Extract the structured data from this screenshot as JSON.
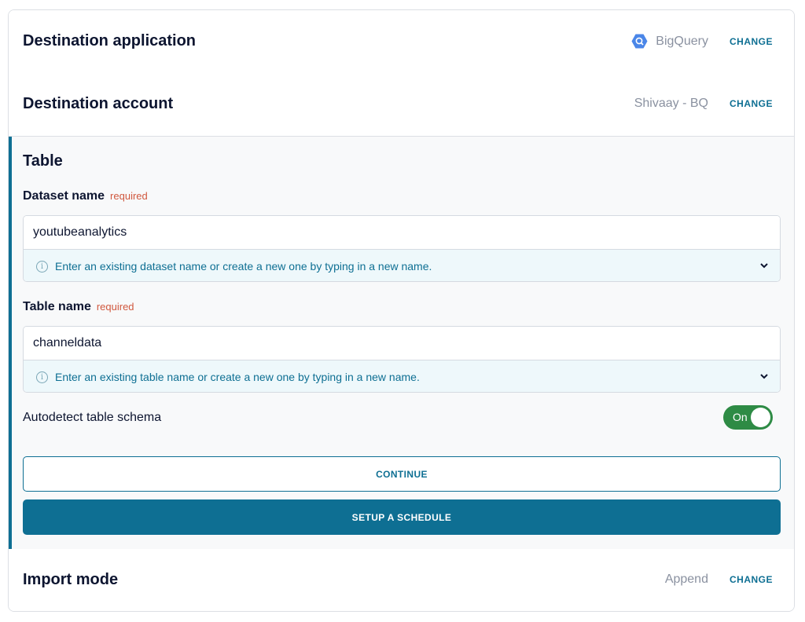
{
  "destination_application": {
    "title": "Destination application",
    "value": "BigQuery",
    "value_icon": "bigquery-icon",
    "change_label": "CHANGE"
  },
  "destination_account": {
    "title": "Destination account",
    "value": "Shivaay - BQ",
    "change_label": "CHANGE"
  },
  "table": {
    "title": "Table",
    "dataset": {
      "label": "Dataset name",
      "required_label": "required",
      "value": "youtubeanalytics",
      "hint": "Enter an existing dataset name or create a new one by typing in a new name."
    },
    "table_name": {
      "label": "Table name",
      "required_label": "required",
      "value": "channeldata",
      "hint": "Enter an existing table name or create a new one by typing in a new name."
    },
    "autodetect": {
      "label": "Autodetect table schema",
      "state": "On",
      "enabled": true
    },
    "continue_label": "CONTINUE",
    "schedule_label": "SETUP A SCHEDULE"
  },
  "import_mode": {
    "title": "Import mode",
    "value": "Append",
    "change_label": "CHANGE"
  },
  "colors": {
    "accent": "#0e6f93",
    "toggle_on": "#2e8b45",
    "required": "#d0583e",
    "hint_bg": "#eef8fb"
  }
}
